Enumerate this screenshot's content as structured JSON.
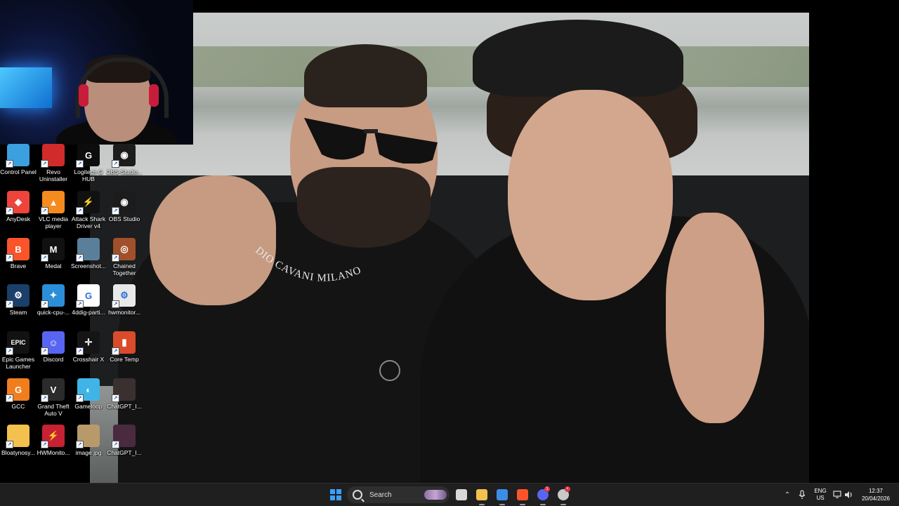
{
  "wallpaper": {
    "collar_text": "DIO CAVANI MILANO"
  },
  "desktop_icons": [
    {
      "label": "Control Panel",
      "icon": "control-panel-icon",
      "color": "#3c9fe0",
      "glyph": ""
    },
    {
      "label": "Revo Uninstaller",
      "icon": "revo-uninstaller-icon",
      "color": "#d12b2b",
      "glyph": ""
    },
    {
      "label": "Logitech G HUB",
      "icon": "logitech-ghub-icon",
      "color": "#0d0d0d",
      "glyph": "G"
    },
    {
      "label": "OBS-Studio...",
      "icon": "obs-studio-icon",
      "color": "#1c1c1c",
      "glyph": "◉"
    },
    {
      "label": "AnyDesk",
      "icon": "anydesk-icon",
      "color": "#ef443b",
      "glyph": "◆"
    },
    {
      "label": "VLC media player",
      "icon": "vlc-icon",
      "color": "#f58b1f",
      "glyph": "▲"
    },
    {
      "label": "Attack Shark Driver v4",
      "icon": "attack-shark-icon",
      "color": "#111111",
      "glyph": "⚡"
    },
    {
      "label": "OBS Studio",
      "icon": "obs-studio-icon",
      "color": "#1c1c1c",
      "glyph": "◉"
    },
    {
      "label": "Brave",
      "icon": "brave-icon",
      "color": "#fb542b",
      "glyph": "B"
    },
    {
      "label": "Medal",
      "icon": "medal-icon",
      "color": "#111111",
      "glyph": "M"
    },
    {
      "label": "Screenshot...",
      "icon": "screenshot-icon",
      "color": "#5a7f9a",
      "glyph": ""
    },
    {
      "label": "Chained Together",
      "icon": "chained-together-icon",
      "color": "#a0502a",
      "glyph": "◎"
    },
    {
      "label": "Steam",
      "icon": "steam-icon",
      "color": "#1b3f6b",
      "glyph": "⚙"
    },
    {
      "label": "quick-cpu-...",
      "icon": "quick-cpu-icon",
      "color": "#2a8fd8",
      "glyph": "✦"
    },
    {
      "label": "4ddig-parti...",
      "icon": "4ddig-icon",
      "color": "#ffffff",
      "glyph": "G"
    },
    {
      "label": "hwmonitor...",
      "icon": "file-icon",
      "color": "#e8e8e8",
      "glyph": "⚙"
    },
    {
      "label": "Epic Games Launcher",
      "icon": "epic-games-icon",
      "color": "#121212",
      "glyph": "EPIC"
    },
    {
      "label": "Discord",
      "icon": "discord-icon",
      "color": "#5865f2",
      "glyph": "☺"
    },
    {
      "label": "Crosshair X",
      "icon": "crosshair-x-icon",
      "color": "#151515",
      "glyph": "✛"
    },
    {
      "label": "Core Temp",
      "icon": "core-temp-icon",
      "color": "#d94b2a",
      "glyph": "▮"
    },
    {
      "label": "GCC",
      "icon": "gcc-icon",
      "color": "#f07d1e",
      "glyph": "G"
    },
    {
      "label": "Grand Theft Auto V",
      "icon": "gta-v-icon",
      "color": "#2b2b2b",
      "glyph": "V"
    },
    {
      "label": "Gameloop",
      "icon": "gameloop-icon",
      "color": "#3fb4e6",
      "glyph": "◐"
    },
    {
      "label": "ChatGPT_I...",
      "icon": "image-file-icon",
      "color": "#3a3030",
      "glyph": ""
    },
    {
      "label": "Bloatynosy...",
      "icon": "folder-icon",
      "color": "#f2c14e",
      "glyph": ""
    },
    {
      "label": "HWMonito...",
      "icon": "hwmonitor-icon",
      "color": "#c62233",
      "glyph": "⚡"
    },
    {
      "label": "image.jpg",
      "icon": "image-file-icon",
      "color": "#b89a6a",
      "glyph": ""
    },
    {
      "label": "ChatGPT_I...",
      "icon": "image-file-icon",
      "color": "#4a2a40",
      "glyph": ""
    }
  ],
  "taskbar": {
    "search_placeholder": "Search",
    "apps": [
      {
        "name": "task-view",
        "color": "#d8d8d8"
      },
      {
        "name": "file-explorer",
        "color": "#f2c14e"
      },
      {
        "name": "microsoft-store",
        "color": "#3a8ee6"
      },
      {
        "name": "brave",
        "color": "#fb542b"
      },
      {
        "name": "discord",
        "color": "#5865f2",
        "badge": "1"
      },
      {
        "name": "chrome-like",
        "color": "#c9c9c9",
        "badge": "•"
      }
    ],
    "language_line1": "ENG",
    "language_line2": "US",
    "time": "12:37",
    "date": "20/04/2026"
  }
}
